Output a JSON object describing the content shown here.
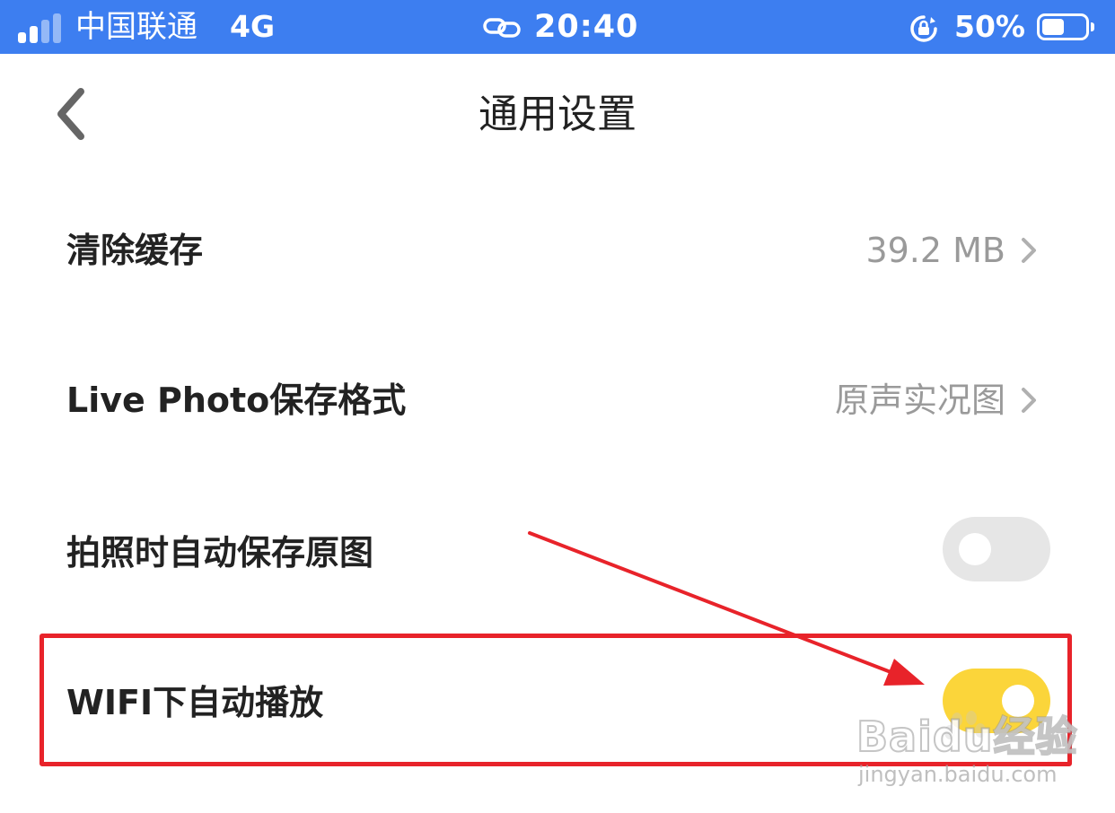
{
  "status_bar": {
    "carrier": "中国联通",
    "network": "4G",
    "time": "20:40",
    "battery_percent": "50%",
    "battery_level": 0.5,
    "signal_bars_active": 2,
    "signal_bars_total": 4,
    "background_color": "#3d7ef0"
  },
  "nav": {
    "title": "通用设置",
    "back_icon": "chevron-left-icon"
  },
  "settings": {
    "clear_cache": {
      "label": "清除缓存",
      "value": "39.2 MB"
    },
    "live_photo_format": {
      "label": "Live Photo保存格式",
      "value": "原声实况图"
    },
    "auto_save_original": {
      "label": "拍照时自动保存原图",
      "enabled": false
    },
    "wifi_autoplay": {
      "label": "WIFI下自动播放",
      "enabled": true
    }
  },
  "colors": {
    "toggle_on": "#fbd53a",
    "toggle_off": "#e6e6e6",
    "annotation": "#e8232a"
  },
  "watermark": {
    "brand": "Baidu经验",
    "url": "jingyan.baidu.com"
  }
}
